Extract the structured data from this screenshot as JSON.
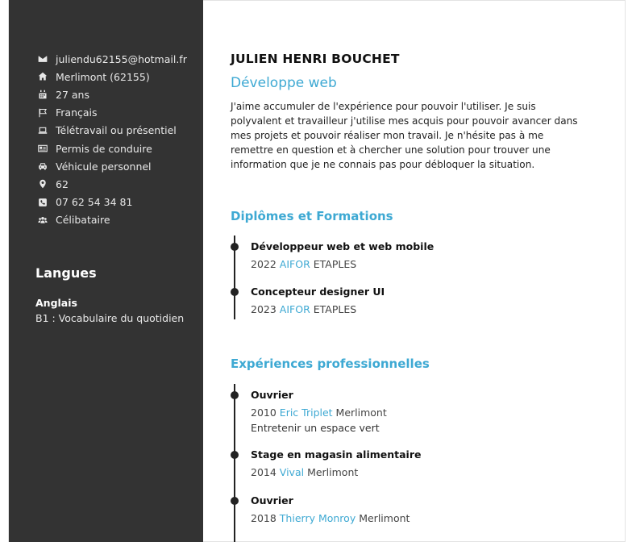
{
  "contact": [
    {
      "icon": "envelope-icon",
      "text": "juliendu62155@hotmail.fr"
    },
    {
      "icon": "home-icon",
      "text": "Merlimont (62155)"
    },
    {
      "icon": "calendar-icon",
      "text": "27 ans"
    },
    {
      "icon": "flag-icon",
      "text": "Français"
    },
    {
      "icon": "laptop-icon",
      "text": "Télétravail ou présentiel"
    },
    {
      "icon": "id-card-icon",
      "text": "Permis de conduire"
    },
    {
      "icon": "car-icon",
      "text": "Véhicule personnel"
    },
    {
      "icon": "map-marker-icon",
      "text": "62"
    },
    {
      "icon": "phone-icon",
      "text": "07 62 54 34 81"
    },
    {
      "icon": "users-icon",
      "text": "Célibataire"
    }
  ],
  "languages": {
    "title": "Langues",
    "items": [
      {
        "name": "Anglais",
        "level": "B1 : Vocabulaire du quotidien"
      }
    ]
  },
  "header": {
    "name": "JULIEN HENRI BOUCHET",
    "role": "Développe web",
    "bio": "J'aime accumuler de l'expérience pour pouvoir l'utiliser. Je suis polyvalent et travailleur j'utilise mes acquis pour pouvoir avancer dans mes projets et pouvoir réaliser mon travail. Je n'hésite pas à me remettre en question et à chercher une solution pour trouver une information que je ne connais pas pour débloquer la situation."
  },
  "education": {
    "title": "Diplômes et Formations",
    "items": [
      {
        "title": "Développeur web et web mobile",
        "year": "2022",
        "org": "AIFOR",
        "place": "ETAPLES"
      },
      {
        "title": "Concepteur designer UI",
        "year": "2023",
        "org": "AIFOR",
        "place": "ETAPLES"
      }
    ]
  },
  "experience": {
    "title": "Expériences professionnelles",
    "items": [
      {
        "title": "Ouvrier",
        "year": "2010",
        "org": "Eric Triplet",
        "place": "Merlimont",
        "desc": "Entretenir un espace vert"
      },
      {
        "title": "Stage en magasin alimentaire",
        "year": "2014",
        "org": "Vival",
        "place": "Merlimont",
        "desc": ""
      },
      {
        "title": "Ouvrier",
        "year": "2018",
        "org": "Thierry Monroy",
        "place": "Merlimont",
        "desc": ""
      }
    ]
  },
  "colors": {
    "accent": "#3ea9d3",
    "sidebar": "#333333"
  }
}
